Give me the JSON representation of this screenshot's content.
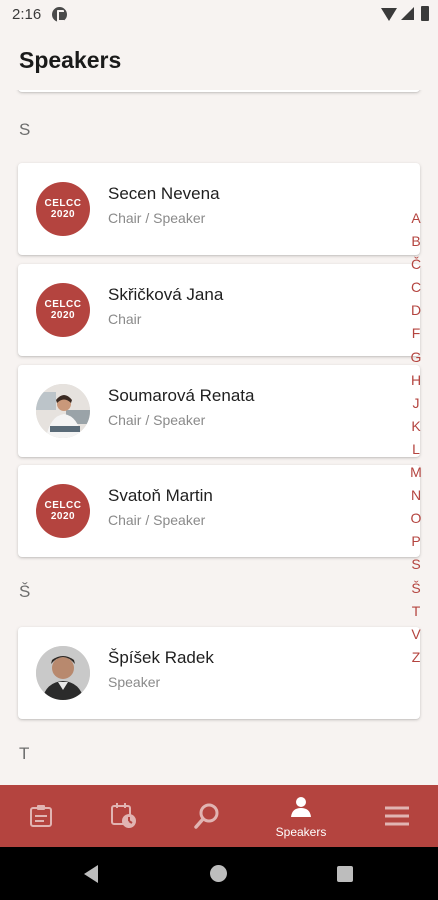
{
  "status_bar": {
    "time": "2:16"
  },
  "app_bar": {
    "title": "Speakers"
  },
  "sections": [
    {
      "letter": "S",
      "speakers": [
        {
          "name": "Secen Nevena",
          "role": "Chair / Speaker",
          "avatar": "logo"
        },
        {
          "name": "Skřičková Jana",
          "role": "Chair",
          "avatar": "logo"
        },
        {
          "name": "Soumarová Renata",
          "role": "Chair / Speaker",
          "avatar": "photo"
        },
        {
          "name": "Svatoň Martin",
          "role": "Chair / Speaker",
          "avatar": "logo"
        }
      ]
    },
    {
      "letter": "Š",
      "speakers": [
        {
          "name": "Špíšek Radek",
          "role": "Speaker",
          "avatar": "photo"
        }
      ]
    },
    {
      "letter": "T",
      "speakers": []
    }
  ],
  "logo": {
    "line1": "CELCC",
    "line2": "2020"
  },
  "alpha_index": [
    "A",
    "B",
    "Č",
    "C",
    "D",
    "F",
    "G",
    "H",
    "J",
    "K",
    "L",
    "M",
    "N",
    "O",
    "P",
    "S",
    "Š",
    "T",
    "V",
    "Z"
  ],
  "bottom_nav": [
    {
      "icon": "clipboard-icon",
      "label": ""
    },
    {
      "icon": "calendar-clock-icon",
      "label": ""
    },
    {
      "icon": "search-icon",
      "label": ""
    },
    {
      "icon": "speakers-icon",
      "label": "Speakers",
      "active": true
    },
    {
      "icon": "menu-icon",
      "label": ""
    }
  ],
  "colors": {
    "accent": "#b4443f",
    "background": "#f7f3f1",
    "card": "#ffffff",
    "index_letter": "#b4443f"
  }
}
